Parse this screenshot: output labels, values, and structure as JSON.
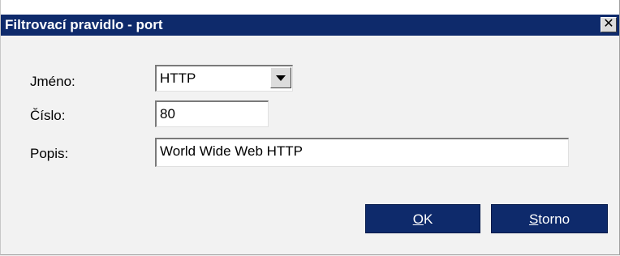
{
  "window": {
    "title": "Filtrovací pravidlo - port",
    "close_glyph": "✕"
  },
  "form": {
    "name_label": "Jméno:",
    "name_value": "HTTP",
    "number_label": "Číslo:",
    "number_value": "80",
    "description_label": "Popis:",
    "description_value": "World Wide Web HTTP"
  },
  "buttons": {
    "ok_mnemonic": "O",
    "ok_rest": "K",
    "cancel_mnemonic": "S",
    "cancel_rest": "torno"
  },
  "colors": {
    "titlebar": "#0e2a6b",
    "button": "#0e2a6b",
    "background": "#f2f2f2"
  },
  "icons": {
    "close": "close-icon",
    "dropdown": "chevron-down-icon"
  }
}
